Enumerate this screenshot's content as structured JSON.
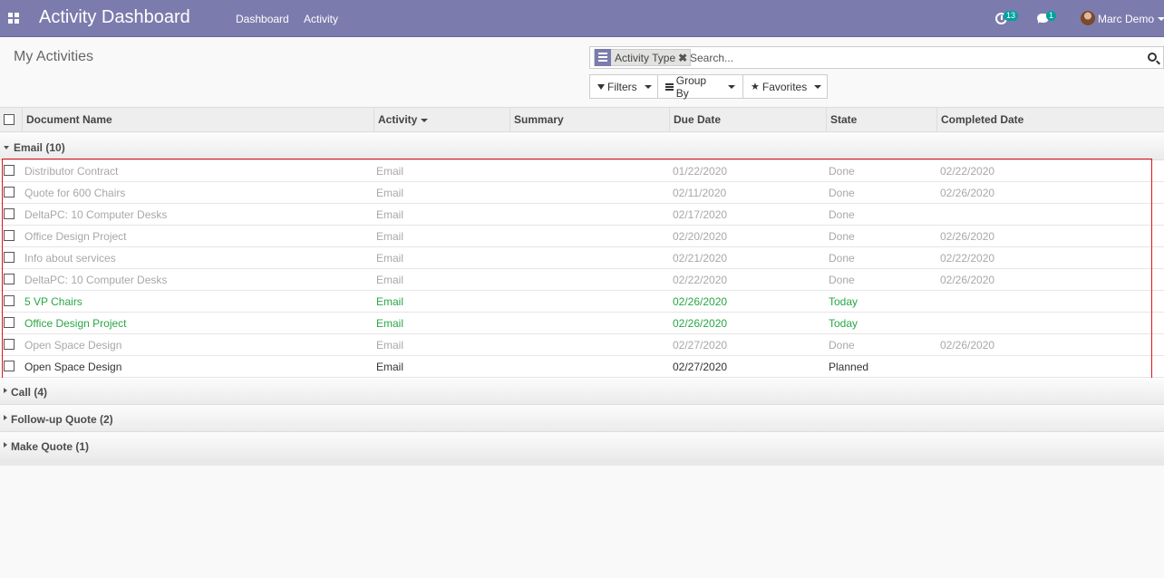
{
  "navbar": {
    "title": "Activity Dashboard",
    "menu": [
      "Dashboard",
      "Activity"
    ],
    "activity_count": "13",
    "message_count": "1",
    "user_name": "Marc Demo"
  },
  "control_panel": {
    "page_title": "My Activities",
    "facet_label": "Activity Type",
    "facet_remove": "✖",
    "search_placeholder": "Search...",
    "filters_label": "Filters",
    "group_by_label": "Group By",
    "favorites_label": "Favorites"
  },
  "table": {
    "columns": [
      "Document Name",
      "Activity",
      "Summary",
      "Due Date",
      "State",
      "Completed Date"
    ],
    "groups": [
      {
        "label": "Email (10)",
        "expanded": true,
        "rows": [
          {
            "document": "Distributor Contract",
            "activity": "Email",
            "summary": "",
            "due": "01/22/2020",
            "state": "Done",
            "completed": "02/22/2020",
            "status": "done"
          },
          {
            "document": "Quote for 600 Chairs",
            "activity": "Email",
            "summary": "",
            "due": "02/11/2020",
            "state": "Done",
            "completed": "02/26/2020",
            "status": "done"
          },
          {
            "document": "DeltaPC: 10 Computer Desks",
            "activity": "Email",
            "summary": "",
            "due": "02/17/2020",
            "state": "Done",
            "completed": "",
            "status": "done"
          },
          {
            "document": "Office Design Project",
            "activity": "Email",
            "summary": "",
            "due": "02/20/2020",
            "state": "Done",
            "completed": "02/26/2020",
            "status": "done"
          },
          {
            "document": "Info about services",
            "activity": "Email",
            "summary": "",
            "due": "02/21/2020",
            "state": "Done",
            "completed": "02/22/2020",
            "status": "done"
          },
          {
            "document": "DeltaPC: 10 Computer Desks",
            "activity": "Email",
            "summary": "",
            "due": "02/22/2020",
            "state": "Done",
            "completed": "02/26/2020",
            "status": "done"
          },
          {
            "document": "5 VP Chairs",
            "activity": "Email",
            "summary": "",
            "due": "02/26/2020",
            "state": "Today",
            "completed": "",
            "status": "today"
          },
          {
            "document": "Office Design Project",
            "activity": "Email",
            "summary": "",
            "due": "02/26/2020",
            "state": "Today",
            "completed": "",
            "status": "today"
          },
          {
            "document": "Open Space Design",
            "activity": "Email",
            "summary": "",
            "due": "02/27/2020",
            "state": "Done",
            "completed": "02/26/2020",
            "status": "done"
          },
          {
            "document": "Open Space Design",
            "activity": "Email",
            "summary": "",
            "due": "02/27/2020",
            "state": "Planned",
            "completed": "",
            "status": "planned"
          }
        ]
      },
      {
        "label": "Call (4)",
        "expanded": false
      },
      {
        "label": "Follow-up Quote (2)",
        "expanded": false
      },
      {
        "label": "Make Quote (1)",
        "expanded": false
      }
    ]
  },
  "colors": {
    "navbar": "#7c7bad",
    "today": "#28a745",
    "done": "#a8a8a8",
    "highlight": "#e0121a"
  }
}
